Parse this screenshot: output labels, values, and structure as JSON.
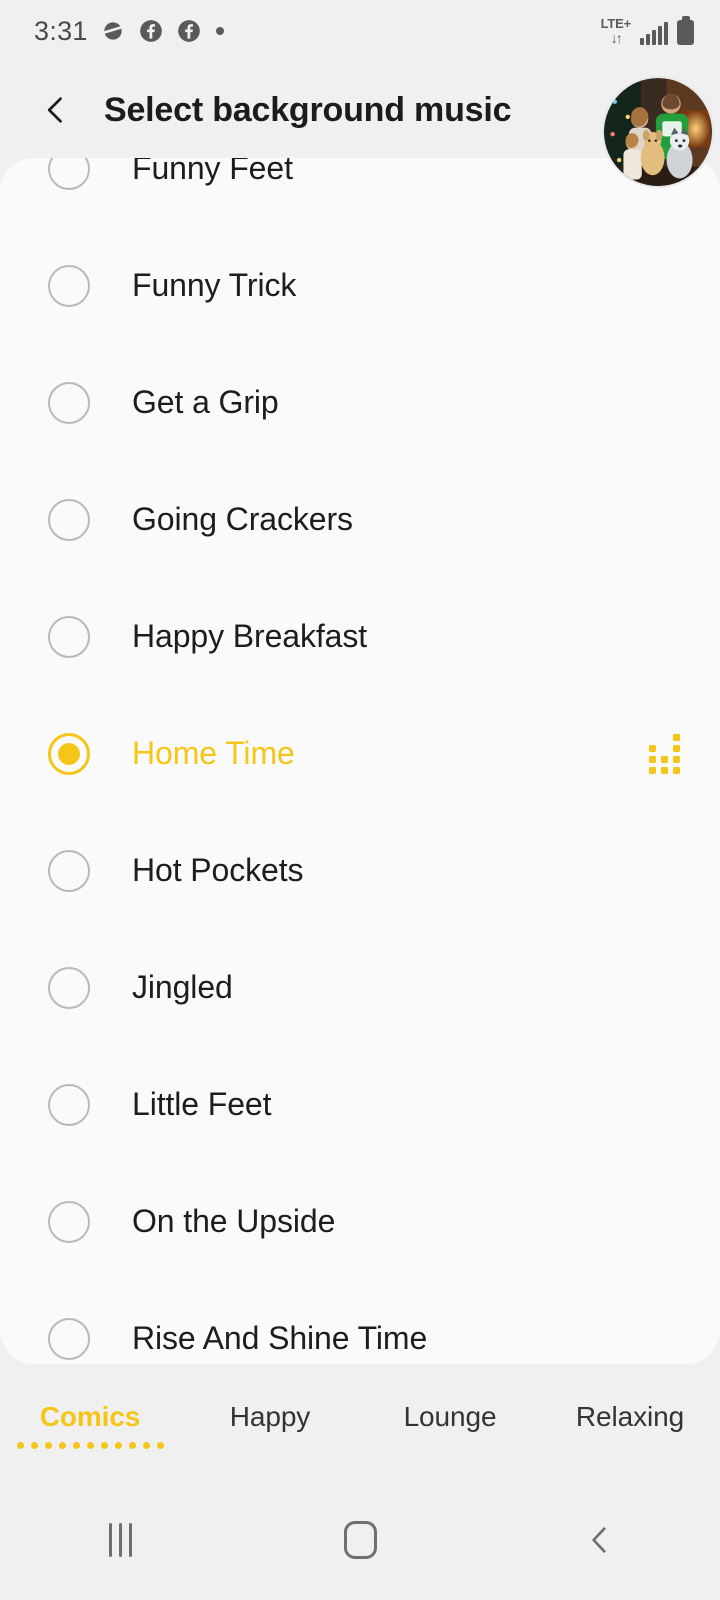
{
  "status_bar": {
    "time": "3:31",
    "left_icons": [
      "samsung-internet-icon",
      "facebook-icon",
      "facebook-icon",
      "dot-indicator-icon"
    ],
    "network_label": "LTE+",
    "network_arrows": "↓↑",
    "signal_icon": "signal-bars-icon",
    "battery_icon": "battery-full-icon"
  },
  "header": {
    "back_icon": "back-chevron-icon",
    "title": "Select background music",
    "avatar_icon": "profile-avatar"
  },
  "music_list": {
    "items": [
      {
        "label": "Funny Feet",
        "selected": false
      },
      {
        "label": "Funny Trick",
        "selected": false
      },
      {
        "label": "Get a Grip",
        "selected": false
      },
      {
        "label": "Going Crackers",
        "selected": false
      },
      {
        "label": "Happy Breakfast",
        "selected": false
      },
      {
        "label": "Home Time",
        "selected": true
      },
      {
        "label": "Hot Pockets",
        "selected": false
      },
      {
        "label": "Jingled",
        "selected": false
      },
      {
        "label": "Little Feet",
        "selected": false
      },
      {
        "label": "On the Upside",
        "selected": false
      },
      {
        "label": "Rise And Shine Time",
        "selected": false
      }
    ],
    "selected_label": "Home Time",
    "playing_indicator_icon": "equalizer-dots-icon"
  },
  "tabs": {
    "active_index": 0,
    "items": [
      {
        "label": "Comics"
      },
      {
        "label": "Happy"
      },
      {
        "label": "Lounge"
      },
      {
        "label": "Relaxing"
      }
    ]
  },
  "nav_bar": {
    "recents_icon": "recents-icon",
    "home_icon": "home-icon",
    "back_icon": "back-icon"
  },
  "colors": {
    "accent": "#f5c518",
    "page_background": "#f0f0f0",
    "panel_background": "#fafafa",
    "text_primary": "#1d1d1d",
    "text_secondary": "#5a5a5a"
  }
}
